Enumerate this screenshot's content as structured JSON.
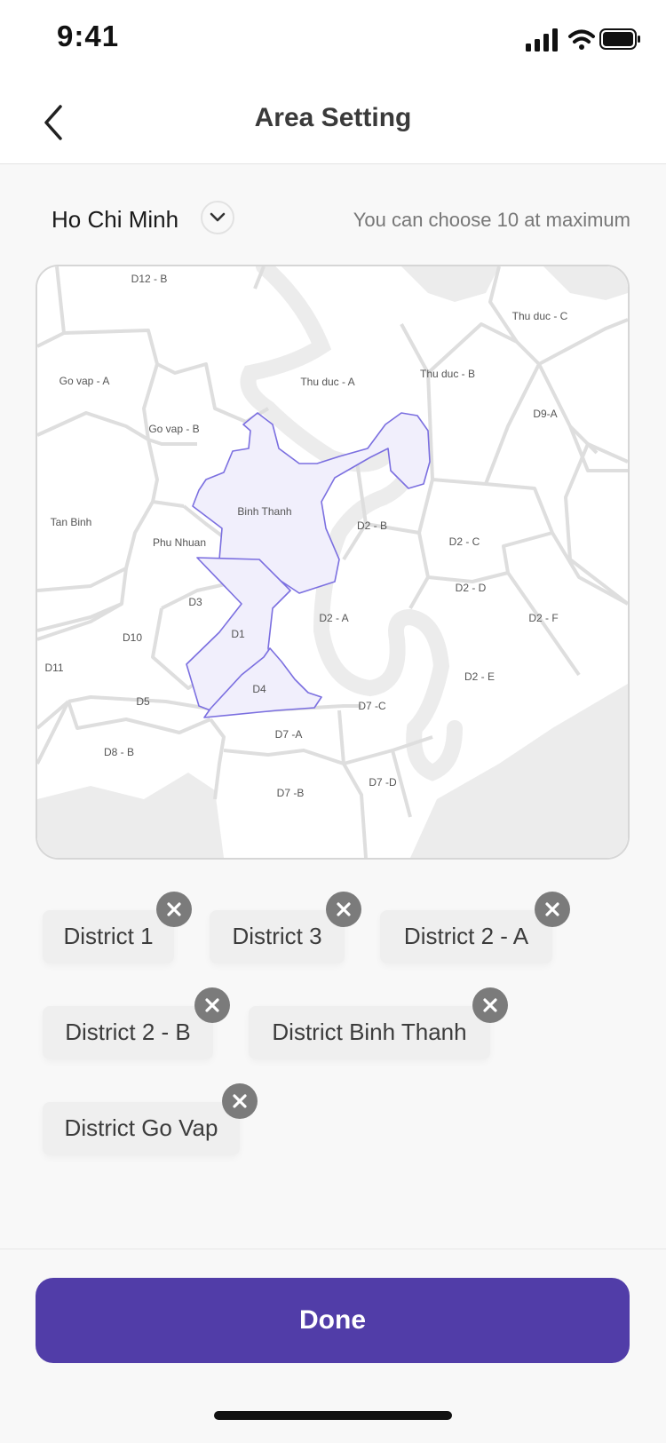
{
  "status_bar": {
    "time": "9:41",
    "icons": [
      "signal-icon",
      "wifi-icon",
      "battery-icon"
    ]
  },
  "nav": {
    "title": "Area Setting",
    "back_icon": "chevron-left-icon"
  },
  "city": {
    "name": "Ho Chi Minh",
    "toggle_icon": "chevron-down-icon",
    "max_hint": "You can choose 10 at maximum"
  },
  "map": {
    "labels": {
      "d12b": "D12 - B",
      "thuducc": "Thu duc - C",
      "govapa": "Go vap - A",
      "thuduca": "Thu duc - A",
      "thuducb": "Thu duc - B",
      "d9a": "D9-A",
      "govapb": "Go vap - B",
      "tanbinh": "Tan Binh",
      "binhthanh": "Binh Thanh",
      "d2b": "D2 - B",
      "phunhuan": "Phu Nhuan",
      "d2c": "D2 - C",
      "d2d": "D2 - D",
      "d3": "D3",
      "d2a": "D2 - A",
      "d2f": "D2 - F",
      "d10": "D10",
      "d1": "D1",
      "d11": "D11",
      "d2e": "D2 - E",
      "d4": "D4",
      "d5": "D5",
      "d7c": "D7 -C",
      "d7a": "D7 -A",
      "d8b": "D8 - B",
      "d7d": "D7 -D",
      "d7b": "D7 -B"
    },
    "highlight_color": "#7b6fe0",
    "highlight_fill": "#f1effc"
  },
  "selected": {
    "chips": [
      {
        "label": "District 1"
      },
      {
        "label": "District 3"
      },
      {
        "label": "District 2 - A"
      },
      {
        "label": "District 2 - B"
      },
      {
        "label": "District Binh Thanh"
      },
      {
        "label": "District Go Vap"
      }
    ],
    "remove_icon": "close-icon"
  },
  "footer": {
    "done_label": "Done",
    "accent": "#513da8"
  }
}
